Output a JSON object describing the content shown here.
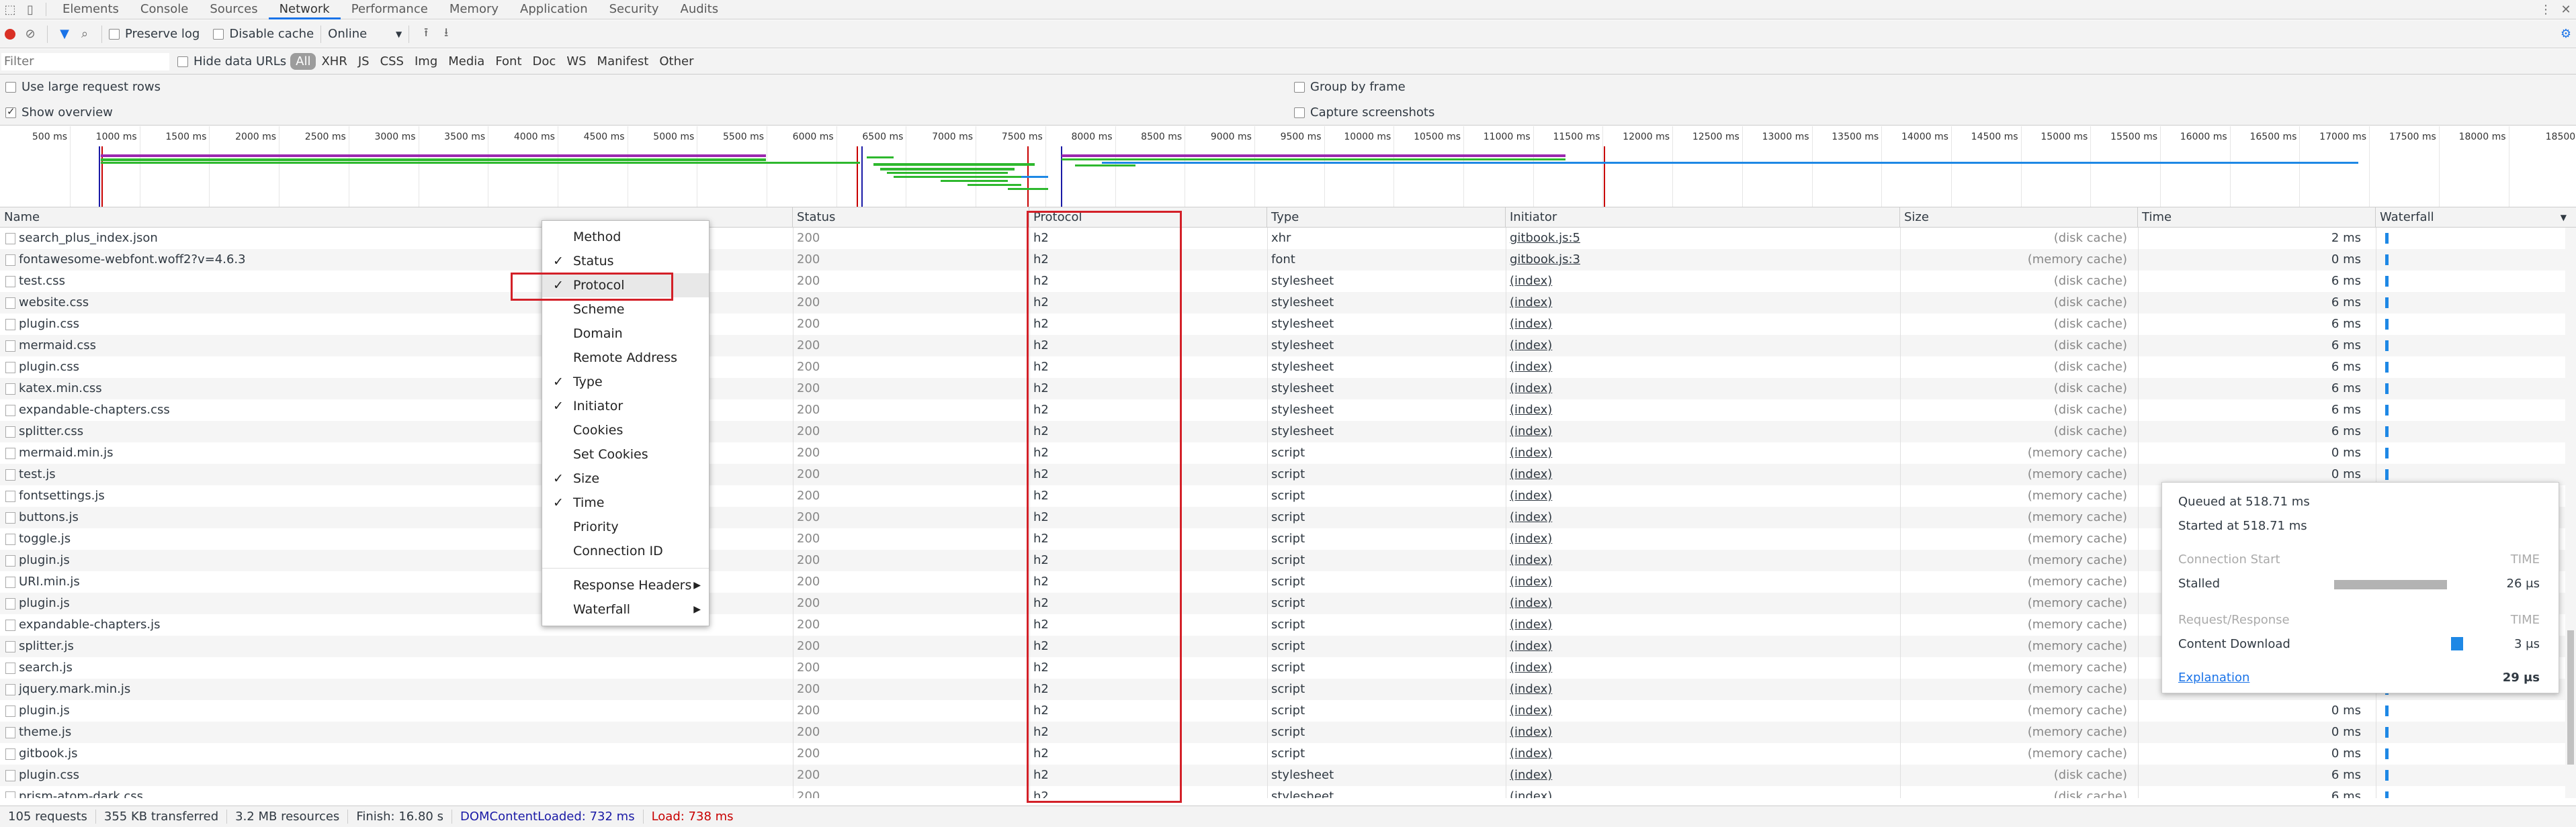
{
  "tabs": [
    "Elements",
    "Console",
    "Sources",
    "Network",
    "Performance",
    "Memory",
    "Application",
    "Security",
    "Audits"
  ],
  "toolbar": {
    "preserve_log": "Preserve log",
    "disable_cache": "Disable cache",
    "throttle": "Online"
  },
  "filter": {
    "placeholder": "Filter",
    "hide_data_urls": "Hide data URLs",
    "types": [
      "All",
      "XHR",
      "JS",
      "CSS",
      "Img",
      "Media",
      "Font",
      "Doc",
      "WS",
      "Manifest",
      "Other"
    ]
  },
  "options": {
    "large_rows": "Use large request rows",
    "show_overview": "Show overview",
    "group_frame": "Group by frame",
    "capture": "Capture screenshots"
  },
  "ticks": [
    "500 ms",
    "1000 ms",
    "1500 ms",
    "2000 ms",
    "2500 ms",
    "3000 ms",
    "3500 ms",
    "4000 ms",
    "4500 ms",
    "5000 ms",
    "5500 ms",
    "6000 ms",
    "6500 ms",
    "7000 ms",
    "7500 ms",
    "8000 ms",
    "8500 ms",
    "9000 ms",
    "9500 ms",
    "10000 ms",
    "10500 ms",
    "11000 ms",
    "11500 ms",
    "12000 ms",
    "12500 ms",
    "13000 ms",
    "13500 ms",
    "14000 ms",
    "14500 ms",
    "15000 ms",
    "15500 ms",
    "16000 ms",
    "16500 ms",
    "17000 ms",
    "17500 ms",
    "18000 ms",
    "18500"
  ],
  "columns": {
    "name": "Name",
    "status": "Status",
    "protocol": "Protocol",
    "type": "Type",
    "initiator": "Initiator",
    "size": "Size",
    "time": "Time",
    "waterfall": "Waterfall"
  },
  "rows": [
    {
      "name": "search_plus_index.json",
      "status": "200",
      "protocol": "h2",
      "type": "xhr",
      "initiator": "gitbook.js:5",
      "size": "(disk cache)",
      "time": "2 ms"
    },
    {
      "name": "fontawesome-webfont.woff2?v=4.6.3",
      "status": "200",
      "protocol": "h2",
      "type": "font",
      "initiator": "gitbook.js:3",
      "size": "(memory cache)",
      "time": "0 ms"
    },
    {
      "name": "test.css",
      "status": "200",
      "protocol": "h2",
      "type": "stylesheet",
      "initiator": "(index)",
      "size": "(disk cache)",
      "time": "6 ms"
    },
    {
      "name": "website.css",
      "status": "200",
      "protocol": "h2",
      "type": "stylesheet",
      "initiator": "(index)",
      "size": "(disk cache)",
      "time": "6 ms"
    },
    {
      "name": "plugin.css",
      "status": "200",
      "protocol": "h2",
      "type": "stylesheet",
      "initiator": "(index)",
      "size": "(disk cache)",
      "time": "6 ms"
    },
    {
      "name": "mermaid.css",
      "status": "200",
      "protocol": "h2",
      "type": "stylesheet",
      "initiator": "(index)",
      "size": "(disk cache)",
      "time": "6 ms"
    },
    {
      "name": "plugin.css",
      "status": "200",
      "protocol": "h2",
      "type": "stylesheet",
      "initiator": "(index)",
      "size": "(disk cache)",
      "time": "6 ms"
    },
    {
      "name": "katex.min.css",
      "status": "200",
      "protocol": "h2",
      "type": "stylesheet",
      "initiator": "(index)",
      "size": "(disk cache)",
      "time": "6 ms"
    },
    {
      "name": "expandable-chapters.css",
      "status": "200",
      "protocol": "h2",
      "type": "stylesheet",
      "initiator": "(index)",
      "size": "(disk cache)",
      "time": "6 ms"
    },
    {
      "name": "splitter.css",
      "status": "200",
      "protocol": "h2",
      "type": "stylesheet",
      "initiator": "(index)",
      "size": "(disk cache)",
      "time": "6 ms"
    },
    {
      "name": "mermaid.min.js",
      "status": "200",
      "protocol": "h2",
      "type": "script",
      "initiator": "(index)",
      "size": "(memory cache)",
      "time": "0 ms"
    },
    {
      "name": "test.js",
      "status": "200",
      "protocol": "h2",
      "type": "script",
      "initiator": "(index)",
      "size": "(memory cache)",
      "time": "0 ms"
    },
    {
      "name": "fontsettings.js",
      "status": "200",
      "protocol": "h2",
      "type": "script",
      "initiator": "(index)",
      "size": "(memory cache)",
      "time": ""
    },
    {
      "name": "buttons.js",
      "status": "200",
      "protocol": "h2",
      "type": "script",
      "initiator": "(index)",
      "size": "(memory cache)",
      "time": ""
    },
    {
      "name": "toggle.js",
      "status": "200",
      "protocol": "h2",
      "type": "script",
      "initiator": "(index)",
      "size": "(memory cache)",
      "time": ""
    },
    {
      "name": "plugin.js",
      "status": "200",
      "protocol": "h2",
      "type": "script",
      "initiator": "(index)",
      "size": "(memory cache)",
      "time": ""
    },
    {
      "name": "URI.min.js",
      "status": "200",
      "protocol": "h2",
      "type": "script",
      "initiator": "(index)",
      "size": "(memory cache)",
      "time": ""
    },
    {
      "name": "plugin.js",
      "status": "200",
      "protocol": "h2",
      "type": "script",
      "initiator": "(index)",
      "size": "(memory cache)",
      "time": ""
    },
    {
      "name": "expandable-chapters.js",
      "status": "200",
      "protocol": "h2",
      "type": "script",
      "initiator": "(index)",
      "size": "(memory cache)",
      "time": ""
    },
    {
      "name": "splitter.js",
      "status": "200",
      "protocol": "h2",
      "type": "script",
      "initiator": "(index)",
      "size": "(memory cache)",
      "time": ""
    },
    {
      "name": "search.js",
      "status": "200",
      "protocol": "h2",
      "type": "script",
      "initiator": "(index)",
      "size": "(memory cache)",
      "time": ""
    },
    {
      "name": "jquery.mark.min.js",
      "status": "200",
      "protocol": "h2",
      "type": "script",
      "initiator": "(index)",
      "size": "(memory cache)",
      "time": ""
    },
    {
      "name": "plugin.js",
      "status": "200",
      "protocol": "h2",
      "type": "script",
      "initiator": "(index)",
      "size": "(memory cache)",
      "time": "0 ms"
    },
    {
      "name": "theme.js",
      "status": "200",
      "protocol": "h2",
      "type": "script",
      "initiator": "(index)",
      "size": "(memory cache)",
      "time": "0 ms"
    },
    {
      "name": "gitbook.js",
      "status": "200",
      "protocol": "h2",
      "type": "script",
      "initiator": "(index)",
      "size": "(memory cache)",
      "time": "0 ms"
    },
    {
      "name": "plugin.css",
      "status": "200",
      "protocol": "h2",
      "type": "stylesheet",
      "initiator": "(index)",
      "size": "(disk cache)",
      "time": "6 ms"
    },
    {
      "name": "prism-atom-dark.css",
      "status": "200",
      "protocol": "h2",
      "type": "stylesheet",
      "initiator": "(index)",
      "size": "(disk cache)",
      "time": "6 ms"
    }
  ],
  "menu": [
    {
      "label": "Method",
      "checked": false
    },
    {
      "label": "Status",
      "checked": true
    },
    {
      "label": "Protocol",
      "checked": true
    },
    {
      "label": "Scheme",
      "checked": false
    },
    {
      "label": "Domain",
      "checked": false
    },
    {
      "label": "Remote Address",
      "checked": false
    },
    {
      "label": "Type",
      "checked": true
    },
    {
      "label": "Initiator",
      "checked": true
    },
    {
      "label": "Cookies",
      "checked": false
    },
    {
      "label": "Set Cookies",
      "checked": false
    },
    {
      "label": "Size",
      "checked": true
    },
    {
      "label": "Time",
      "checked": true
    },
    {
      "label": "Priority",
      "checked": false
    },
    {
      "label": "Connection ID",
      "checked": false
    },
    {
      "label": "Response Headers",
      "checked": false,
      "submenu": true
    },
    {
      "label": "Waterfall",
      "checked": false,
      "submenu": true
    }
  ],
  "tooltip": {
    "queued": "Queued at 518.71 ms",
    "started": "Started at 518.71 ms",
    "conn_start": "Connection Start",
    "time_hdr": "TIME",
    "stalled": "Stalled",
    "stalled_val": "26 μs",
    "req_resp": "Request/Response",
    "time_hdr2": "TIME",
    "download": "Content Download",
    "download_val": "3 μs",
    "explanation": "Explanation",
    "total": "29 μs"
  },
  "status": {
    "requests": "105 requests",
    "transferred": "355 KB transferred",
    "resources": "3.2 MB resources",
    "finish": "Finish: 16.80 s",
    "dcl": "DOMContentLoaded: 732 ms",
    "load": "Load: 738 ms"
  },
  "colors": {
    "accent": "#1a73e8",
    "highlight": "#d32028",
    "dcl": "#1a1aa6",
    "load": "#c80000"
  }
}
